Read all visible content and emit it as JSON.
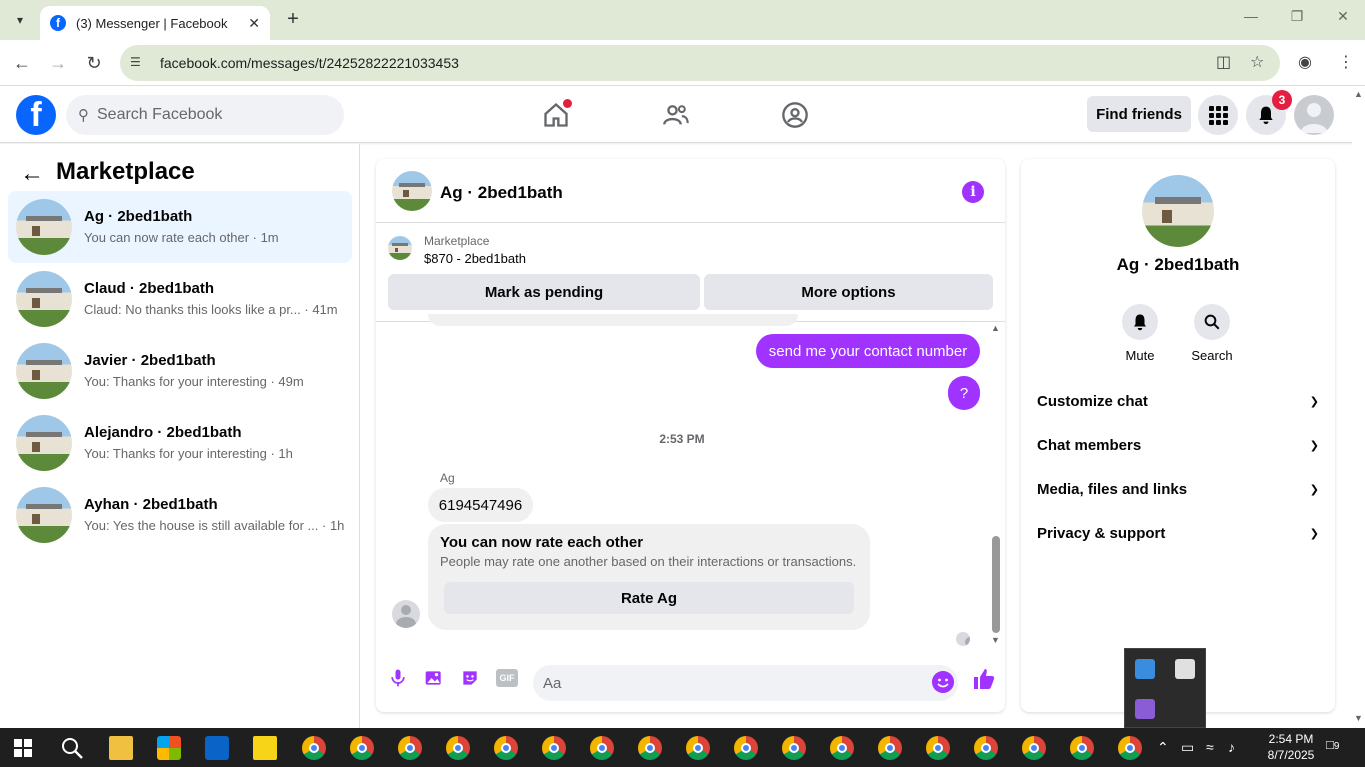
{
  "browser": {
    "tab_title": "(3) Messenger | Facebook",
    "url": "facebook.com/messages/t/24252822221033453",
    "new_tab_label": "+"
  },
  "header": {
    "search_placeholder": "Search Facebook",
    "find_friends": "Find friends",
    "notifications_count": "3"
  },
  "sidebar": {
    "title": "Marketplace",
    "conversations": [
      {
        "name": "Ag · 2bed1bath",
        "snippet": "You can now rate each other · 1m"
      },
      {
        "name": "Claud · 2bed1bath",
        "snippet": "Claud: No thanks this looks like a pr... · 41m"
      },
      {
        "name": "Javier · 2bed1bath",
        "snippet": "You: Thanks for your interesting · 49m"
      },
      {
        "name": "Alejandro · 2bed1bath",
        "snippet": "You: Thanks for your interesting · 1h"
      },
      {
        "name": "Ayhan · 2bed1bath",
        "snippet": "You: Yes the house is still available for ... · 1h"
      }
    ]
  },
  "chat": {
    "title": "Ag · 2bed1bath",
    "marketplace_label": "Marketplace",
    "listing": "$870 - 2bed1bath",
    "mark_pending": "Mark as pending",
    "more_options": "More options",
    "messages": {
      "out1": "send me your contact number",
      "out2": "?",
      "time": "2:53 PM",
      "sender": "Ag",
      "in1": "6194547496"
    },
    "rate_card": {
      "title": "You can now rate each other",
      "desc": "People may rate one another based on their interactions or transactions.",
      "button": "Rate Ag"
    },
    "composer_placeholder": "Aa",
    "gif_label": "GIF"
  },
  "right_panel": {
    "name": "Ag · 2bed1bath",
    "mute": "Mute",
    "search": "Search",
    "sections": [
      "Customize chat",
      "Chat members",
      "Media, files and links",
      "Privacy & support"
    ]
  },
  "taskbar": {
    "time": "2:54 PM",
    "date": "8/7/2025",
    "notif_count": "9"
  },
  "colors": {
    "accent_purple": "#a033ff",
    "fb_blue": "#0866ff",
    "active_row": "#ebf5ff"
  }
}
